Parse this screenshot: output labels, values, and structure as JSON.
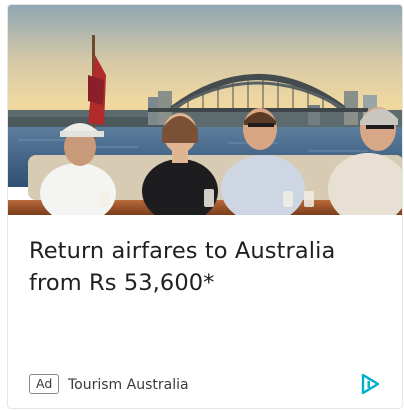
{
  "ad": {
    "headline": "Return airfares to Australia from Rs 53,600*",
    "badge": "Ad",
    "advertiser": "Tourism Australia",
    "image_alt": "Four people on a boat in Sydney Harbour with the Harbour Bridge behind"
  },
  "icons": {
    "adchoices": "adchoices-icon"
  },
  "colors": {
    "headline": "#1f1f1f",
    "muted_text": "#3a3a3a",
    "adchoices": "#00aecd"
  }
}
